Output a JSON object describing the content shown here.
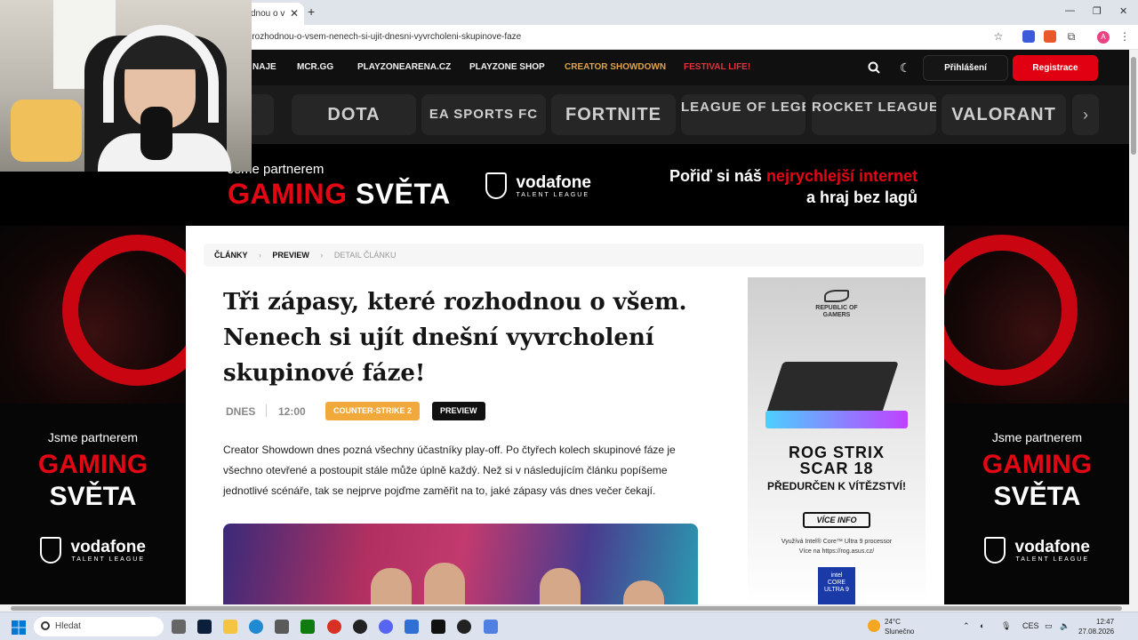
{
  "browser": {
    "tab_title": "dnou o v",
    "tab_close": "✕",
    "new_tab": "+",
    "url": "-rozhodnou-o-vsem-nenech-si-ujit-dnesni-vyvrcholeni-skupinove-faze",
    "profile_initial": "A",
    "win_controls": [
      "—",
      "❐",
      "✕"
    ]
  },
  "site_nav": {
    "items": [
      "NAJE",
      "MCR.GG",
      "PLAYZONEARENA.CZ",
      "PLAYZONE SHOP",
      "CREATOR SHOWDOWN",
      "FESTIVAL LIFE!"
    ],
    "login_label": "Přihlášení",
    "register_label": "Registrace",
    "accent_gold": "#e0a24a",
    "accent_red": "#e3323c"
  },
  "games": [
    "",
    "DOTA",
    "EA SPORTS FC",
    "FORTNITE",
    "LEAGUE OF LEGENDS",
    "ROCKET LEAGUE",
    "VALORANT"
  ],
  "banner": {
    "partner_text": "Jsme partnerem",
    "gaming_red": "GAMING",
    "gaming_white": "SVĚTA",
    "vodafone": "vodafone",
    "talent_league": "TALENT LEAGUE",
    "promo_line1_white": "Pořiď si náš ",
    "promo_line1_red": "nejrychlejší internet",
    "promo_line2": "a hraj bez lagů"
  },
  "breadcrumb": [
    "ČLÁNKY",
    "PREVIEW",
    "DETAIL ČLÁNKU"
  ],
  "article": {
    "title": "Tři zápasy, které rozhodnou o všem. Nenech si ujít dnešní vyvrcholení skupinové fáze!",
    "date": "DNES",
    "time": "12:00",
    "tag_game": "COUNTER-STRIKE 2",
    "tag_type": "PREVIEW",
    "lead": "Creator Showdown dnes pozná všechny účastníky play-off. Po čtyřech kolech skupinové fáze je všechno otevřené a postoupit stále může úplně každý. Než si v následujícím článku popíšeme jednotlivé scénáře, tak se nejprve pojďme zaměřit na to, jaké zápasy vás dnes večer čekají."
  },
  "rog_ad": {
    "brand_line1": "REPUBLIC OF",
    "brand_line2": "GAMERS",
    "model_line1": "ROG STRIX",
    "model_line2": "SCAR 18",
    "slogan": "PŘEDURČEN K VÍTĚZSTVÍ!",
    "button": "VÍCE INFO",
    "fine_line1": "Využívá Intel® Core™ Ultra 9 processor",
    "fine_line2": "Více na https://rog.asus.cz/",
    "intel_line1": "intel",
    "intel_line2": "CORE",
    "intel_line3": "ULTRA 9"
  },
  "side_ad": {
    "partner_text": "Jsme partnerem",
    "gaming": "GAMING",
    "sveta": "SVĚTA",
    "vodafone": "vodafone",
    "talent_league": "TALENT LEAGUE"
  },
  "taskbar": {
    "search_placeholder": "Hledat",
    "weather_temp": "24°C",
    "weather_desc": "Slunečno",
    "lang": "CES",
    "time": "12:47",
    "date": "27.08.2026"
  }
}
